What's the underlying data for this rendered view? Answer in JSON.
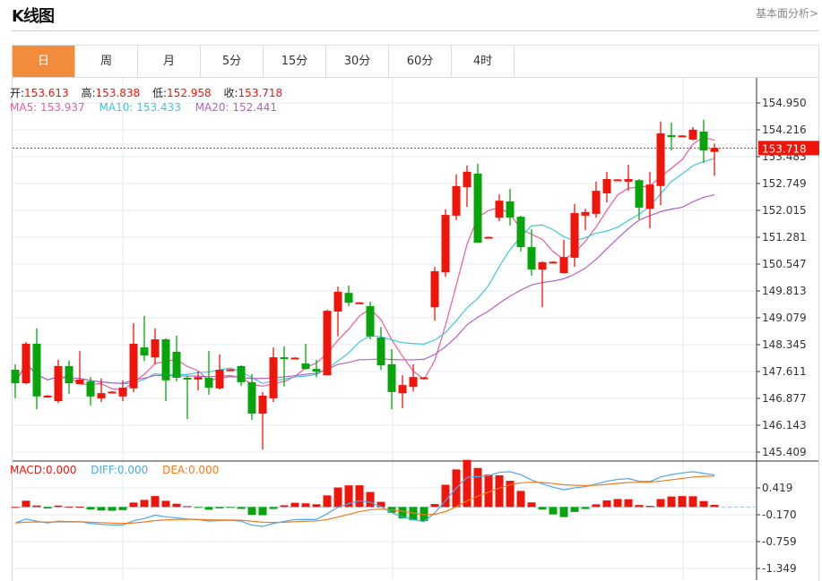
{
  "header": {
    "title": "K线图",
    "link": "基本面分析>"
  },
  "tabs": [
    "日",
    "周",
    "月",
    "5分",
    "15分",
    "30分",
    "60分",
    "4时"
  ],
  "active_tab": 0,
  "ohlc_info": {
    "open_label": "开:",
    "open": "153.613",
    "high_label": "高:",
    "high": "153.838",
    "low_label": "低:",
    "low": "152.958",
    "close_label": "收:",
    "close": "153.718"
  },
  "ma_info": {
    "ma5": "MA5: 153.937",
    "ma10": "MA10: 153.433",
    "ma20": "MA20: 152.441"
  },
  "macd_info": {
    "macd": "MACD:0.000",
    "diff": "DIFF:0.000",
    "dea": "DEA:0.000"
  },
  "current_price": "153.718",
  "colors": {
    "up": "#f0140a",
    "down": "#07a50b",
    "ma5": "#ef5b9c",
    "ma10": "#3ec8dc",
    "ma20": "#b55fc9",
    "diff": "#4aa8f0",
    "dea": "#f07a1e",
    "tab_active": "#f28c3c"
  },
  "chart_data": {
    "type": "candlestick",
    "price_ticks": [
      "154.950",
      "154.216",
      "153.483",
      "152.749",
      "152.015",
      "151.281",
      "150.547",
      "149.813",
      "149.079",
      "148.345",
      "147.611",
      "146.877",
      "146.143",
      "145.409"
    ],
    "price_range": [
      145.409,
      154.95
    ],
    "macd_ticks": [
      "0.419",
      "-0.170",
      "-0.759",
      "-1.349"
    ],
    "macd_range": [
      -1.349,
      0.419
    ],
    "grid": true,
    "candles": [
      [
        147.66,
        147.81,
        146.88,
        147.29
      ],
      [
        147.29,
        148.42,
        147.27,
        148.37
      ],
      [
        148.37,
        148.79,
        146.58,
        146.93
      ],
      [
        146.93,
        146.97,
        146.9,
        146.95
      ],
      [
        146.8,
        147.93,
        146.75,
        147.76
      ],
      [
        147.76,
        147.91,
        147.0,
        147.29
      ],
      [
        147.27,
        148.17,
        147.27,
        147.39
      ],
      [
        147.34,
        147.46,
        146.68,
        146.93
      ],
      [
        146.88,
        147.42,
        146.78,
        147.02
      ],
      [
        147.04,
        147.07,
        147.03,
        147.06
      ],
      [
        146.93,
        147.37,
        146.8,
        147.17
      ],
      [
        147.15,
        148.93,
        147.05,
        148.37
      ],
      [
        148.27,
        149.13,
        147.9,
        148.05
      ],
      [
        148.0,
        148.79,
        147.81,
        148.49
      ],
      [
        148.49,
        148.52,
        146.8,
        147.37
      ],
      [
        148.15,
        148.59,
        147.34,
        147.44
      ],
      [
        147.44,
        147.49,
        146.31,
        147.39
      ],
      [
        147.39,
        147.61,
        147.1,
        147.46
      ],
      [
        147.44,
        148.17,
        146.98,
        147.17
      ],
      [
        147.15,
        148.08,
        147.12,
        147.66
      ],
      [
        147.65,
        147.69,
        147.64,
        147.67
      ],
      [
        147.76,
        147.78,
        147.22,
        147.32
      ],
      [
        147.32,
        147.54,
        146.29,
        146.46
      ],
      [
        146.46,
        147.05,
        145.48,
        146.95
      ],
      [
        146.88,
        148.27,
        146.78,
        148.0
      ],
      [
        148.0,
        148.3,
        147.2,
        147.95
      ],
      [
        147.97,
        148.0,
        147.96,
        147.99
      ],
      [
        147.83,
        148.37,
        147.66,
        147.68
      ],
      [
        147.68,
        147.93,
        147.46,
        147.61
      ],
      [
        147.51,
        149.3,
        147.51,
        149.27
      ],
      [
        149.25,
        149.93,
        148.57,
        149.79
      ],
      [
        149.76,
        149.96,
        149.4,
        149.49
      ],
      [
        149.48,
        149.51,
        149.47,
        149.5
      ],
      [
        149.4,
        149.52,
        148.49,
        148.57
      ],
      [
        148.54,
        148.83,
        147.66,
        147.78
      ],
      [
        147.81,
        148.22,
        146.58,
        147.05
      ],
      [
        147.02,
        147.51,
        146.61,
        147.24
      ],
      [
        147.19,
        147.81,
        147.07,
        147.46
      ],
      [
        147.43,
        147.46,
        147.42,
        147.45
      ],
      [
        149.37,
        150.47,
        149.0,
        150.35
      ],
      [
        150.32,
        152.04,
        150.2,
        151.89
      ],
      [
        151.87,
        153.0,
        151.75,
        152.68
      ],
      [
        152.65,
        153.24,
        152.11,
        153.07
      ],
      [
        153.02,
        153.29,
        151.13,
        151.13
      ],
      [
        151.27,
        151.3,
        151.26,
        151.29
      ],
      [
        151.82,
        152.45,
        151.72,
        152.28
      ],
      [
        152.26,
        152.6,
        151.6,
        151.82
      ],
      [
        151.84,
        151.87,
        150.89,
        151.01
      ],
      [
        151.01,
        151.5,
        150.23,
        150.4
      ],
      [
        150.4,
        150.62,
        149.37,
        150.6
      ],
      [
        150.59,
        150.62,
        150.58,
        150.61
      ],
      [
        150.3,
        151.21,
        150.3,
        150.74
      ],
      [
        150.72,
        152.19,
        150.47,
        151.94
      ],
      [
        151.87,
        152.06,
        151.48,
        151.97
      ],
      [
        151.92,
        152.8,
        151.82,
        152.55
      ],
      [
        152.48,
        153.07,
        152.23,
        152.87
      ],
      [
        152.84,
        152.87,
        152.83,
        152.86
      ],
      [
        152.8,
        153.26,
        152.55,
        152.87
      ],
      [
        152.84,
        152.87,
        151.77,
        152.09
      ],
      [
        152.06,
        153.07,
        151.53,
        152.72
      ],
      [
        152.68,
        154.44,
        152.16,
        154.12
      ],
      [
        154.07,
        154.41,
        153.65,
        154.02
      ],
      [
        154.04,
        154.07,
        154.03,
        154.06
      ],
      [
        153.95,
        154.29,
        153.92,
        154.22
      ],
      [
        154.17,
        154.49,
        153.31,
        153.65
      ],
      [
        153.613,
        153.838,
        152.958,
        153.718
      ]
    ]
  }
}
